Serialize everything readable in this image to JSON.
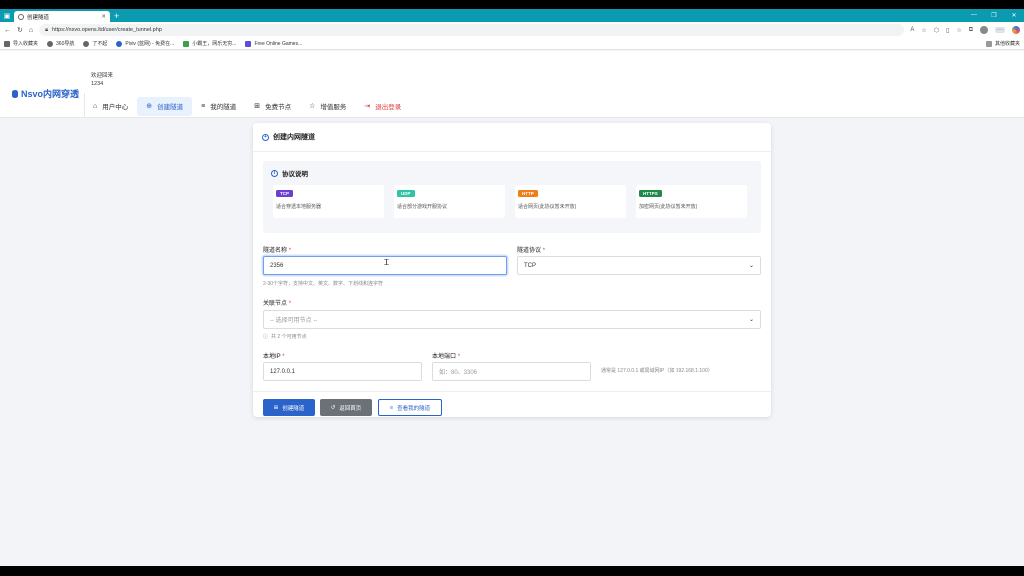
{
  "browser": {
    "tab_title": "创建隧道",
    "url": "https://nsvo.opens.ltd/user/create_tunnel.php",
    "bookmarks": [
      "导入收藏夹",
      "360导航",
      "了不起",
      "Pixiv (蓝网) - 免费在...",
      "小霸王，网乐无穷...",
      "Free Online Games..."
    ],
    "bookmarks_right": "其他收藏夹"
  },
  "site": {
    "brand": "Nsvo内网穿透",
    "welcome_label": "欢迎回来",
    "username": "1234",
    "nav": [
      {
        "label": "用户中心",
        "icon": "⌂"
      },
      {
        "label": "创建隧道",
        "icon": "⊕"
      },
      {
        "label": "我的隧道",
        "icon": "≡"
      },
      {
        "label": "免费节点",
        "icon": "⊞"
      },
      {
        "label": "增值服务",
        "icon": "☆"
      },
      {
        "label": "退出登录",
        "icon": "⇥"
      }
    ]
  },
  "form": {
    "title": "创建内网隧道",
    "protocol_section_title": "协议说明",
    "protocols": [
      {
        "badge": "TCP",
        "desc": "适合穿透本地服务器",
        "color": "#6c3fd1"
      },
      {
        "badge": "UDP",
        "desc": "适合部分游戏开服协议",
        "color": "#2ec4a5"
      },
      {
        "badge": "HTTP",
        "desc": "适合网页(此协议暂未开放)",
        "color": "#f07f19"
      },
      {
        "badge": "HTTPS",
        "desc": "加密网页(此协议暂未开放)",
        "color": "#1e8a4c"
      }
    ],
    "tunnel_name_label": "隧道名称",
    "tunnel_name_value": "2356",
    "tunnel_name_hint": "2-30个字符，支持中文、英文、数字、下划线和连字符",
    "tunnel_protocol_label": "隧道协议",
    "tunnel_protocol_value": "TCP",
    "node_label": "关联节点",
    "node_placeholder": "-- 选择可用节点 --",
    "node_hint": "共 2 个可用节点",
    "local_ip_label": "本地IP",
    "local_ip_value": "127.0.0.1",
    "local_port_label": "本地端口",
    "local_port_placeholder": "如：80、3306",
    "ip_note": "通常是 127.0.0.1 或局域网IP（如 192.168.1.100）",
    "required_mark": "*",
    "buttons": {
      "create": "创建隧道",
      "back": "返回首页",
      "view": "查看我的隧道"
    }
  }
}
